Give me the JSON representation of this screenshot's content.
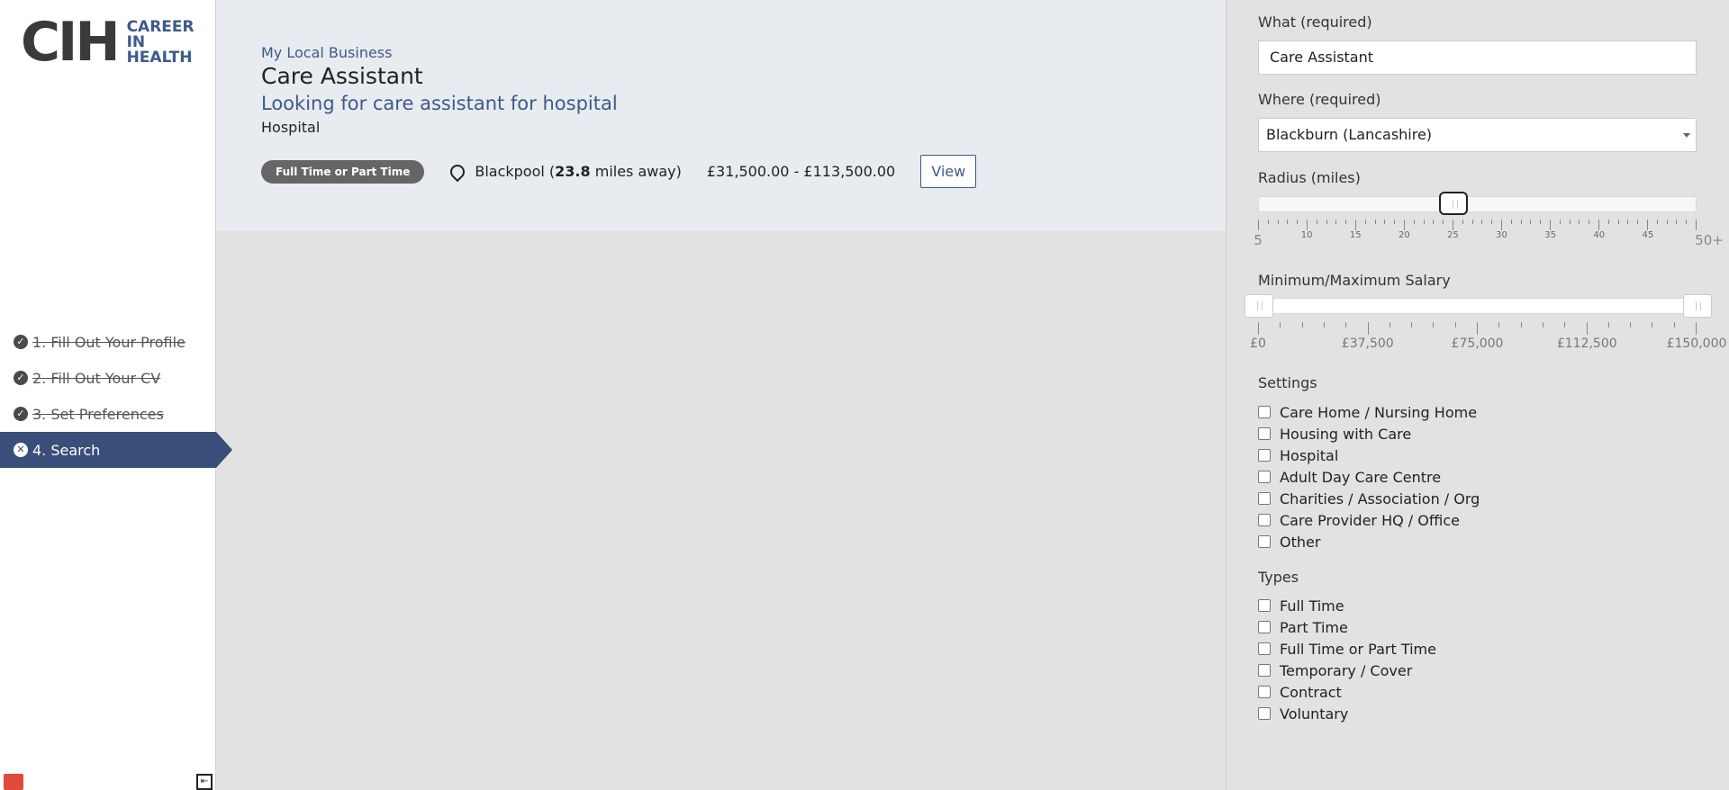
{
  "sidebar": {
    "logo": {
      "main": "CIH",
      "line1": "CAREER",
      "line2": "IN",
      "line3": "HEALTH"
    },
    "steps": [
      {
        "label": "1. Fill Out Your Profile",
        "state": "done"
      },
      {
        "label": "2. Fill Out Your CV",
        "state": "done"
      },
      {
        "label": "3. Set Preferences",
        "state": "done"
      },
      {
        "label": "4. Search",
        "state": "active"
      }
    ]
  },
  "result": {
    "company": "My Local Business",
    "title": "Care Assistant",
    "description": "Looking for care assistant for hospital",
    "setting": "Hospital",
    "badge": "Full Time or Part Time",
    "location_town": "Blackpool (",
    "distance": "23.8",
    "distance_suffix": " miles away)",
    "salary": "£31,500.00 - £113,500.00",
    "view_label": "View"
  },
  "filters": {
    "what_label": "What (required)",
    "what_value": "Care Assistant",
    "where_label": "Where (required)",
    "where_value": "Blackburn (Lancashire)",
    "radius_label": "Radius (miles)",
    "radius_value": 25,
    "radius_min": 5,
    "radius_max": 50,
    "radius_ticks": [
      "5",
      "10",
      "15",
      "20",
      "25",
      "30",
      "35",
      "40",
      "45",
      "50+"
    ],
    "salary_label": "Minimum/Maximum Salary",
    "salary_min_value": 0,
    "salary_max_value": 150000,
    "salary_ticks": [
      "£0",
      "£37,500",
      "£75,000",
      "£112,500",
      "£150,000"
    ],
    "settings_title": "Settings",
    "settings": [
      "Care Home / Nursing Home",
      "Housing with Care",
      "Hospital",
      "Adult Day Care Centre",
      "Charities / Association / Org",
      "Care Provider HQ / Office",
      "Other"
    ],
    "types_title": "Types",
    "types": [
      "Full Time",
      "Part Time",
      "Full Time or Part Time",
      "Temporary / Cover",
      "Contract",
      "Voluntary"
    ]
  },
  "colors": {
    "accent": "#394e78",
    "link": "#3d5a8a",
    "badge": "#666666"
  }
}
